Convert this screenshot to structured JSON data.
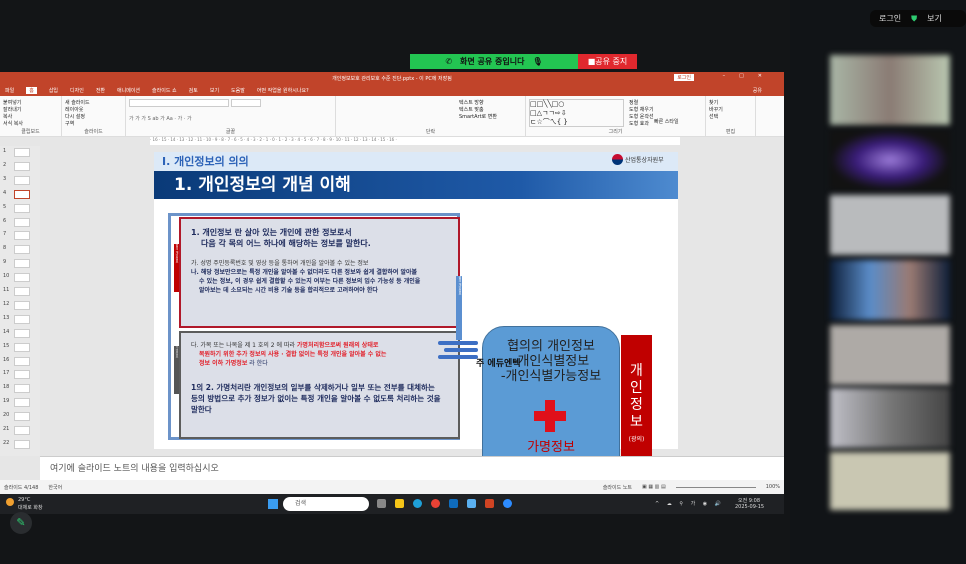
{
  "zoom": {
    "sharing": "화면 공유 중입니다",
    "stop": "공유 중지",
    "login": "로그인",
    "view": "보기"
  },
  "ppt": {
    "title": "개인정보보호 관리보호 수준 진단.pptx - 이 PC에 저장됨",
    "login_btn": "로그인",
    "menu": [
      "파일",
      "홈",
      "삽입",
      "디자인",
      "전환",
      "애니메이션",
      "슬라이드 쇼",
      "검토",
      "보기",
      "도움말",
      "어떤 작업을 원하시나요?"
    ],
    "share": "공유",
    "groups": [
      {
        "label": "클립보드",
        "items": [
          "붙여넣기",
          "잘라내기",
          "복사",
          "서식 복사"
        ]
      },
      {
        "label": "슬라이드",
        "items": [
          "새 슬라이드",
          "레이아웃",
          "다시 설정",
          "구역"
        ]
      },
      {
        "label": "글꼴",
        "items": []
      },
      {
        "label": "단락",
        "items": [
          "텍스트 방향",
          "텍스트 맞춤",
          "SmartArt로 변환"
        ]
      },
      {
        "label": "그리기",
        "items": [
          "정렬",
          "빠른 스타일",
          "도형 채우기",
          "도형 윤곽선",
          "도형 효과"
        ]
      },
      {
        "label": "편집",
        "items": [
          "찾기",
          "바꾸기",
          "선택"
        ]
      }
    ],
    "ruler": "· 16 · 15 · 14 · 13 · 12 · 11 · 10 · 9 · 8 · 7 · 6 · 5 · 4 · 3 · 2 · 1 · 0 · 1 · 2 · 3 · 4 · 5 · 6 · 7 · 8 · 9 · 10 · 11 · 12 · 13 · 14 · 15 · 16 ·",
    "thumbs": [
      "1",
      "2",
      "3",
      "4",
      "5",
      "6",
      "7",
      "8",
      "9",
      "10",
      "11",
      "12",
      "13",
      "14",
      "15",
      "16",
      "17",
      "18",
      "19",
      "20",
      "21",
      "22"
    ],
    "notes_placeholder": "여기에 슬라이드 노트의 내용을 입력하십시오",
    "status": {
      "slide": "슬라이드 4/148",
      "lang": "한국어",
      "notes": "슬라이드 노트",
      "zoom": "100%"
    }
  },
  "slide": {
    "section": "Ⅰ.  개인정보의 의의",
    "title": "1. 개인정보의 개념 이해",
    "logo": "산업통상자원부",
    "red_tag": "협의 개인정보",
    "gray_tag": "가명정보",
    "side_tag": "광의 개인정보",
    "def1": "1. 개인정보 란 살아 있는 개인에 관한 정보로서",
    "def2": "다음 각 목의 어느 하나에 해당하는 정보를 말한다.",
    "ga": "가. 성명 주민등록번호 및 영상 등을 통하여 개인을 알아볼 수 있는 정보",
    "na1": "나. 해당 정보만으로는 특정 개인을 알아볼 수 없더라도 다른 정보와 쉽게 결합하여 알아볼",
    "na2": "수 있는 정보, 이 경우 쉽게 결합할 수 있는지 여부는 다른 정보의 입수 가능성 등 개인을",
    "na3": "알아보는 데 소요되는 시간 비용 기술 등을 합리적으로 고려하여야 한다",
    "da_pre": "다. 가목 또는 나목을 제 1 호의 2 에 따라 ",
    "da_red1": "가명처리함으로써 원래의 상태로",
    "da_red2": "복원하기 위한 추가 정보의 사용 · 결합 없이는 특정 개인을 알아볼 수 없는",
    "da_red3": "정보 이하 가명정보",
    "da_post": " 라 한다",
    "p1": "1의 2. 가명처리란 개인정보의 일부를 삭제하거나 일부 또는 전부를 대체하는",
    "p2": "등의 방법으로 추가 정보가 없이는 특정 개인을 알아볼 수 없도록 처리하는 것을",
    "p3": "말한다",
    "blue1": "협의의 개인정보",
    "blue2": "-개인식별정보",
    "blue3": "-개인식별가능정보",
    "overlay": "주 에듀엔텍",
    "pseudonym": "가명정보",
    "red_rect": [
      "개",
      "인",
      "정",
      "보"
    ],
    "red_sub": "(광의)"
  },
  "taskbar": {
    "weather_temp": "29°C",
    "weather_desc": "대체로 화창",
    "search": "검색",
    "time": "오전 9:08",
    "date": "2025-09-15"
  }
}
